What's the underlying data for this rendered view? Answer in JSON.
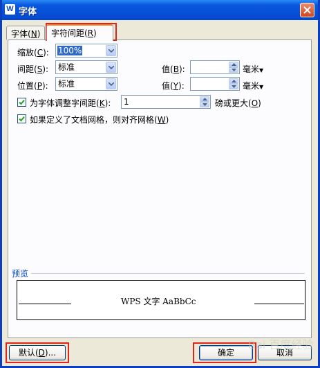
{
  "window": {
    "title": "字体",
    "app_icon_letter": "W"
  },
  "tabs": [
    {
      "label": "字体",
      "hotkey": "N",
      "active": false
    },
    {
      "label": "字符间距",
      "hotkey": "R",
      "active": true
    }
  ],
  "fields": {
    "scale": {
      "label": "缩放",
      "hotkey": "C",
      "value": "100%"
    },
    "spacing": {
      "label": "间距",
      "hotkey": "S",
      "value": "标准"
    },
    "spacing_value": {
      "label": "值",
      "hotkey": "B",
      "value": "",
      "unit": "毫米"
    },
    "position": {
      "label": "位置",
      "hotkey": "P",
      "value": "标准"
    },
    "position_value": {
      "label": "值",
      "hotkey": "Y",
      "value": "",
      "unit": "毫米"
    }
  },
  "kerning": {
    "label": "为字体调整字间距",
    "hotkey": "K",
    "checked": true,
    "value": "1",
    "suffix": "磅或更大",
    "suffix_hotkey": "O"
  },
  "grid_align": {
    "label": "如果定义了文档网格，则对齐网格",
    "hotkey": "W",
    "checked": true
  },
  "preview": {
    "label": "预览",
    "sample": "WPS 文字  AaBbCc"
  },
  "buttons": {
    "default": {
      "label": "默认",
      "hotkey": "D",
      "suffix": "..."
    },
    "ok": "确定",
    "cancel": "取消"
  },
  "watermark": "Bai 百度经验",
  "colors": {
    "highlight_box": "#e2231a",
    "title_bar": "#0751d8",
    "dialog_bg": "#ece9d8"
  }
}
